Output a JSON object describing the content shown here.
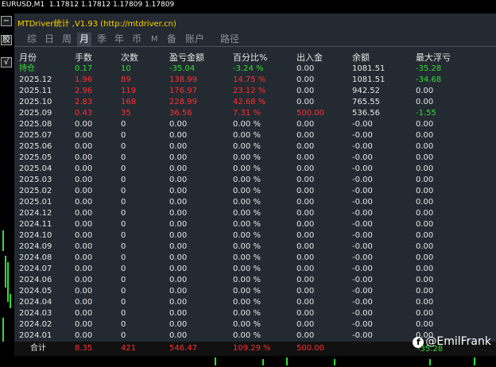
{
  "ticker": "EURUSD,M1  1.17812 1.17812 1.17809 1.17809",
  "side_buttons": [
    "−",
    "胶",
    "√"
  ],
  "title": "MTDriver统计 ,V1.93 (http://mtdriver.cn)",
  "tabs": [
    {
      "label": "综",
      "active": false
    },
    {
      "label": "日",
      "active": false
    },
    {
      "label": "周",
      "active": false
    },
    {
      "label": "月",
      "active": true
    },
    {
      "label": "季",
      "active": false
    },
    {
      "label": "年",
      "active": false
    },
    {
      "label": "币",
      "active": false
    },
    {
      "label": "M",
      "active": false
    },
    {
      "label": "备",
      "active": false
    },
    {
      "label": "账户",
      "active": false
    },
    {
      "label": "路径",
      "active": false
    }
  ],
  "columns": [
    "月份",
    "手数",
    "次数",
    "盈亏金额",
    "百分比%",
    "出入金",
    "余额",
    "最大浮亏"
  ],
  "rows": [
    {
      "cells": [
        "持仓",
        "0.17",
        "10",
        "-35.04",
        "-3.24 %",
        "0.00",
        "1081.51",
        "-35.28"
      ],
      "colors": [
        "g",
        "g",
        "g",
        "g",
        "g",
        "w",
        "w",
        "g"
      ]
    },
    {
      "cells": [
        "2025.12",
        "1.96",
        "89",
        "138.99",
        "14.75 %",
        "0.00",
        "1081.51",
        "-34.68"
      ],
      "colors": [
        "w",
        "r",
        "r",
        "r",
        "r",
        "w",
        "w",
        "g"
      ]
    },
    {
      "cells": [
        "2025.11",
        "2.96",
        "119",
        "176.97",
        "23.12 %",
        "0.00",
        "942.52",
        "0.00"
      ],
      "colors": [
        "w",
        "r",
        "r",
        "r",
        "r",
        "w",
        "w",
        "w"
      ]
    },
    {
      "cells": [
        "2025.10",
        "2.83",
        "168",
        "228.99",
        "42.68 %",
        "0.00",
        "765.55",
        "0.00"
      ],
      "colors": [
        "w",
        "r",
        "r",
        "r",
        "r",
        "w",
        "w",
        "w"
      ]
    },
    {
      "cells": [
        "2025.09",
        "0.43",
        "35",
        "36.56",
        "7.31 %",
        "500.00",
        "536.56",
        "-1.55"
      ],
      "colors": [
        "w",
        "r",
        "r",
        "r",
        "r",
        "r",
        "w",
        "g"
      ]
    },
    {
      "cells": [
        "2025.08",
        "0.00",
        "0",
        "0.00",
        "0.00 %",
        "0.00",
        "-0.00",
        "0.00"
      ],
      "colors": [
        "w",
        "w",
        "w",
        "w",
        "w",
        "w",
        "w",
        "w"
      ]
    },
    {
      "cells": [
        "2025.07",
        "0.00",
        "0",
        "0.00",
        "0.00 %",
        "0.00",
        "-0.00",
        "0.00"
      ],
      "colors": [
        "w",
        "w",
        "w",
        "w",
        "w",
        "w",
        "w",
        "w"
      ]
    },
    {
      "cells": [
        "2025.06",
        "0.00",
        "0",
        "0.00",
        "0.00 %",
        "0.00",
        "-0.00",
        "0.00"
      ],
      "colors": [
        "w",
        "w",
        "w",
        "w",
        "w",
        "w",
        "w",
        "w"
      ]
    },
    {
      "cells": [
        "2025.05",
        "0.00",
        "0",
        "0.00",
        "0.00 %",
        "0.00",
        "-0.00",
        "0.00"
      ],
      "colors": [
        "w",
        "w",
        "w",
        "w",
        "w",
        "w",
        "w",
        "w"
      ]
    },
    {
      "cells": [
        "2025.04",
        "0.00",
        "0",
        "0.00",
        "0.00 %",
        "0.00",
        "-0.00",
        "0.00"
      ],
      "colors": [
        "w",
        "w",
        "w",
        "w",
        "w",
        "w",
        "w",
        "w"
      ]
    },
    {
      "cells": [
        "2025.03",
        "0.00",
        "0",
        "0.00",
        "0.00 %",
        "0.00",
        "-0.00",
        "0.00"
      ],
      "colors": [
        "w",
        "w",
        "w",
        "w",
        "w",
        "w",
        "w",
        "w"
      ]
    },
    {
      "cells": [
        "2025.02",
        "0.00",
        "0",
        "0.00",
        "0.00 %",
        "0.00",
        "-0.00",
        "0.00"
      ],
      "colors": [
        "w",
        "w",
        "w",
        "w",
        "w",
        "w",
        "w",
        "w"
      ]
    },
    {
      "cells": [
        "2025.01",
        "0.00",
        "0",
        "0.00",
        "0.00 %",
        "0.00",
        "-0.00",
        "0.00"
      ],
      "colors": [
        "w",
        "w",
        "w",
        "w",
        "w",
        "w",
        "w",
        "w"
      ]
    },
    {
      "cells": [
        "2024.12",
        "0.00",
        "0",
        "0.00",
        "0.00 %",
        "0.00",
        "-0.00",
        "0.00"
      ],
      "colors": [
        "w",
        "w",
        "w",
        "w",
        "w",
        "w",
        "w",
        "w"
      ]
    },
    {
      "cells": [
        "2024.11",
        "0.00",
        "0",
        "0.00",
        "0.00 %",
        "0.00",
        "-0.00",
        "0.00"
      ],
      "colors": [
        "w",
        "w",
        "w",
        "w",
        "w",
        "w",
        "w",
        "w"
      ]
    },
    {
      "cells": [
        "2024.10",
        "0.00",
        "0",
        "0.00",
        "0.00 %",
        "0.00",
        "-0.00",
        "0.00"
      ],
      "colors": [
        "w",
        "w",
        "w",
        "w",
        "w",
        "w",
        "w",
        "w"
      ]
    },
    {
      "cells": [
        "2024.09",
        "0.00",
        "0",
        "0.00",
        "0.00 %",
        "0.00",
        "-0.00",
        "0.00"
      ],
      "colors": [
        "w",
        "w",
        "w",
        "w",
        "w",
        "w",
        "w",
        "w"
      ]
    },
    {
      "cells": [
        "2024.08",
        "0.00",
        "0",
        "0.00",
        "0.00 %",
        "0.00",
        "-0.00",
        "0.00"
      ],
      "colors": [
        "w",
        "w",
        "w",
        "w",
        "w",
        "w",
        "w",
        "w"
      ]
    },
    {
      "cells": [
        "2024.07",
        "0.00",
        "0",
        "0.00",
        "0.00 %",
        "0.00",
        "-0.00",
        "0.00"
      ],
      "colors": [
        "w",
        "w",
        "w",
        "w",
        "w",
        "w",
        "w",
        "w"
      ]
    },
    {
      "cells": [
        "2024.06",
        "0.00",
        "0",
        "0.00",
        "0.00 %",
        "0.00",
        "-0.00",
        "0.00"
      ],
      "colors": [
        "w",
        "w",
        "w",
        "w",
        "w",
        "w",
        "w",
        "w"
      ]
    },
    {
      "cells": [
        "2024.05",
        "0.00",
        "0",
        "0.00",
        "0.00 %",
        "0.00",
        "-0.00",
        "0.00"
      ],
      "colors": [
        "w",
        "w",
        "w",
        "w",
        "w",
        "w",
        "w",
        "w"
      ]
    },
    {
      "cells": [
        "2024.04",
        "0.00",
        "0",
        "0.00",
        "0.00 %",
        "0.00",
        "-0.00",
        "0.00"
      ],
      "colors": [
        "w",
        "w",
        "w",
        "w",
        "w",
        "w",
        "w",
        "w"
      ]
    },
    {
      "cells": [
        "2024.03",
        "0.00",
        "0",
        "0.00",
        "0.00 %",
        "0.00",
        "-0.00",
        "0.00"
      ],
      "colors": [
        "w",
        "w",
        "w",
        "w",
        "w",
        "w",
        "w",
        "w"
      ]
    },
    {
      "cells": [
        "2024.02",
        "0.00",
        "0",
        "0.00",
        "0.00 %",
        "0.00",
        "-0.00",
        "0.00"
      ],
      "colors": [
        "w",
        "w",
        "w",
        "w",
        "w",
        "w",
        "w",
        "w"
      ]
    },
    {
      "cells": [
        "2024.01",
        "0.00",
        "0",
        "0.00",
        "0.00 %",
        "0.00",
        "-0.00",
        "0.00"
      ],
      "colors": [
        "w",
        "w",
        "w",
        "w",
        "w",
        "w",
        "w",
        "w"
      ]
    }
  ],
  "footer": {
    "cells": [
      "合计",
      "8.35",
      "421",
      "546.47",
      "109.29 %",
      "500.00",
      "",
      ""
    ],
    "colors": [
      "w",
      "r",
      "r",
      "r",
      "r",
      "r",
      "w",
      "w"
    ]
  },
  "watermark": "@EmilFrank",
  "watermark_icon": "facebook-icon",
  "under_watermark_value": "-35.28",
  "colors": {
    "green": "#33dd33",
    "red": "#ff3030",
    "title": "#ffd200",
    "panel": "#232a32"
  }
}
